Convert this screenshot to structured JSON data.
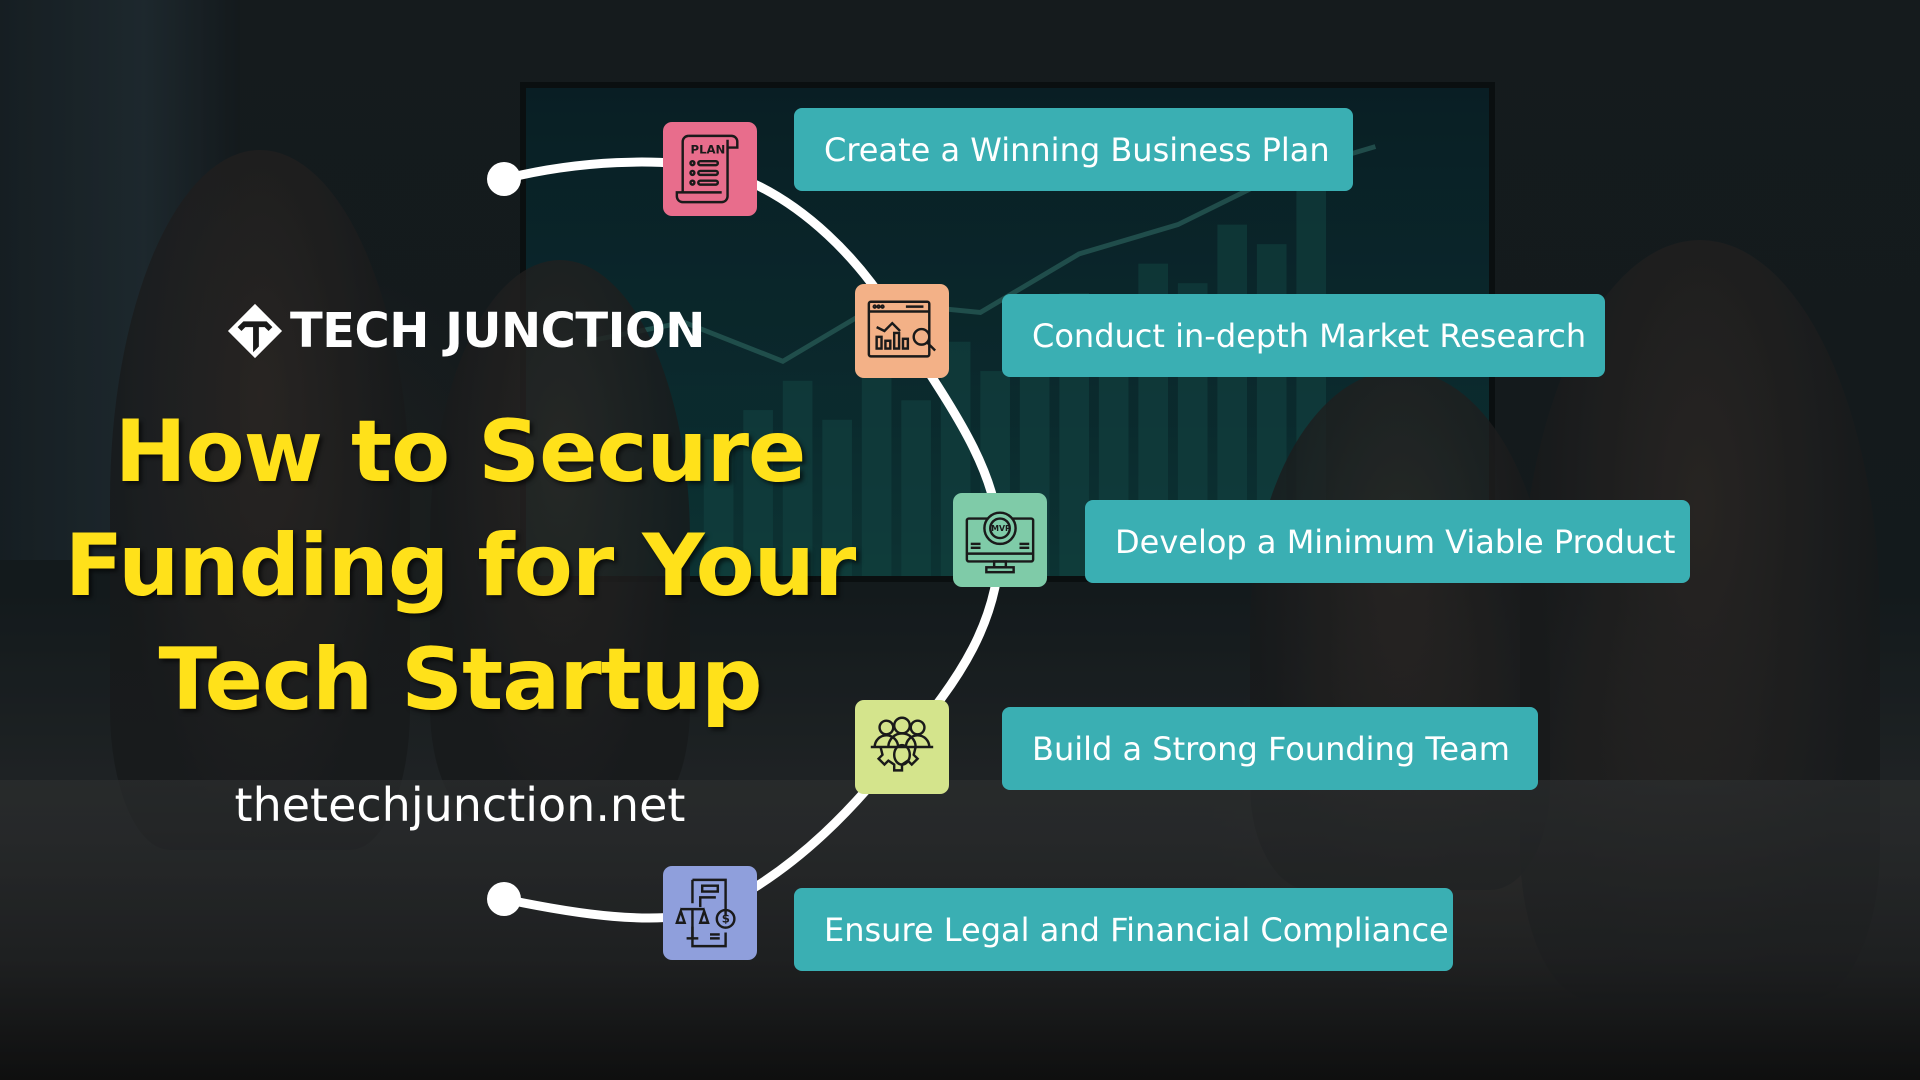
{
  "brand": {
    "logo_text": "TECH JUNCTION",
    "logo_icon": "tech-junction-diamond-logo"
  },
  "title": {
    "lines": [
      "How to Secure",
      "Funding for Your",
      "Tech Startup"
    ]
  },
  "website": "thetechjunction.net",
  "steps": [
    {
      "label": "Create a Winning Business Plan",
      "icon": "business-plan-scroll-icon",
      "icon_bg": "#e86d8c"
    },
    {
      "label": "Conduct in-depth Market Research",
      "icon": "market-research-analytics-icon",
      "icon_bg": "#f3b187"
    },
    {
      "label": "Develop a Minimum Viable Product",
      "icon": "mvp-gear-monitor-icon",
      "icon_bg": "#7fcba8"
    },
    {
      "label": "Build a Strong Founding Team",
      "icon": "founding-team-gear-icon",
      "icon_bg": "#d4e48c"
    },
    {
      "label": "Ensure Legal and Financial Compliance",
      "icon": "legal-financial-scale-icon",
      "icon_bg": "#8f9fdc"
    }
  ],
  "colors": {
    "title": "#ffe11a",
    "step_box": "#3aafb3",
    "text_light": "#ffffff",
    "connector": "#ffffff"
  }
}
